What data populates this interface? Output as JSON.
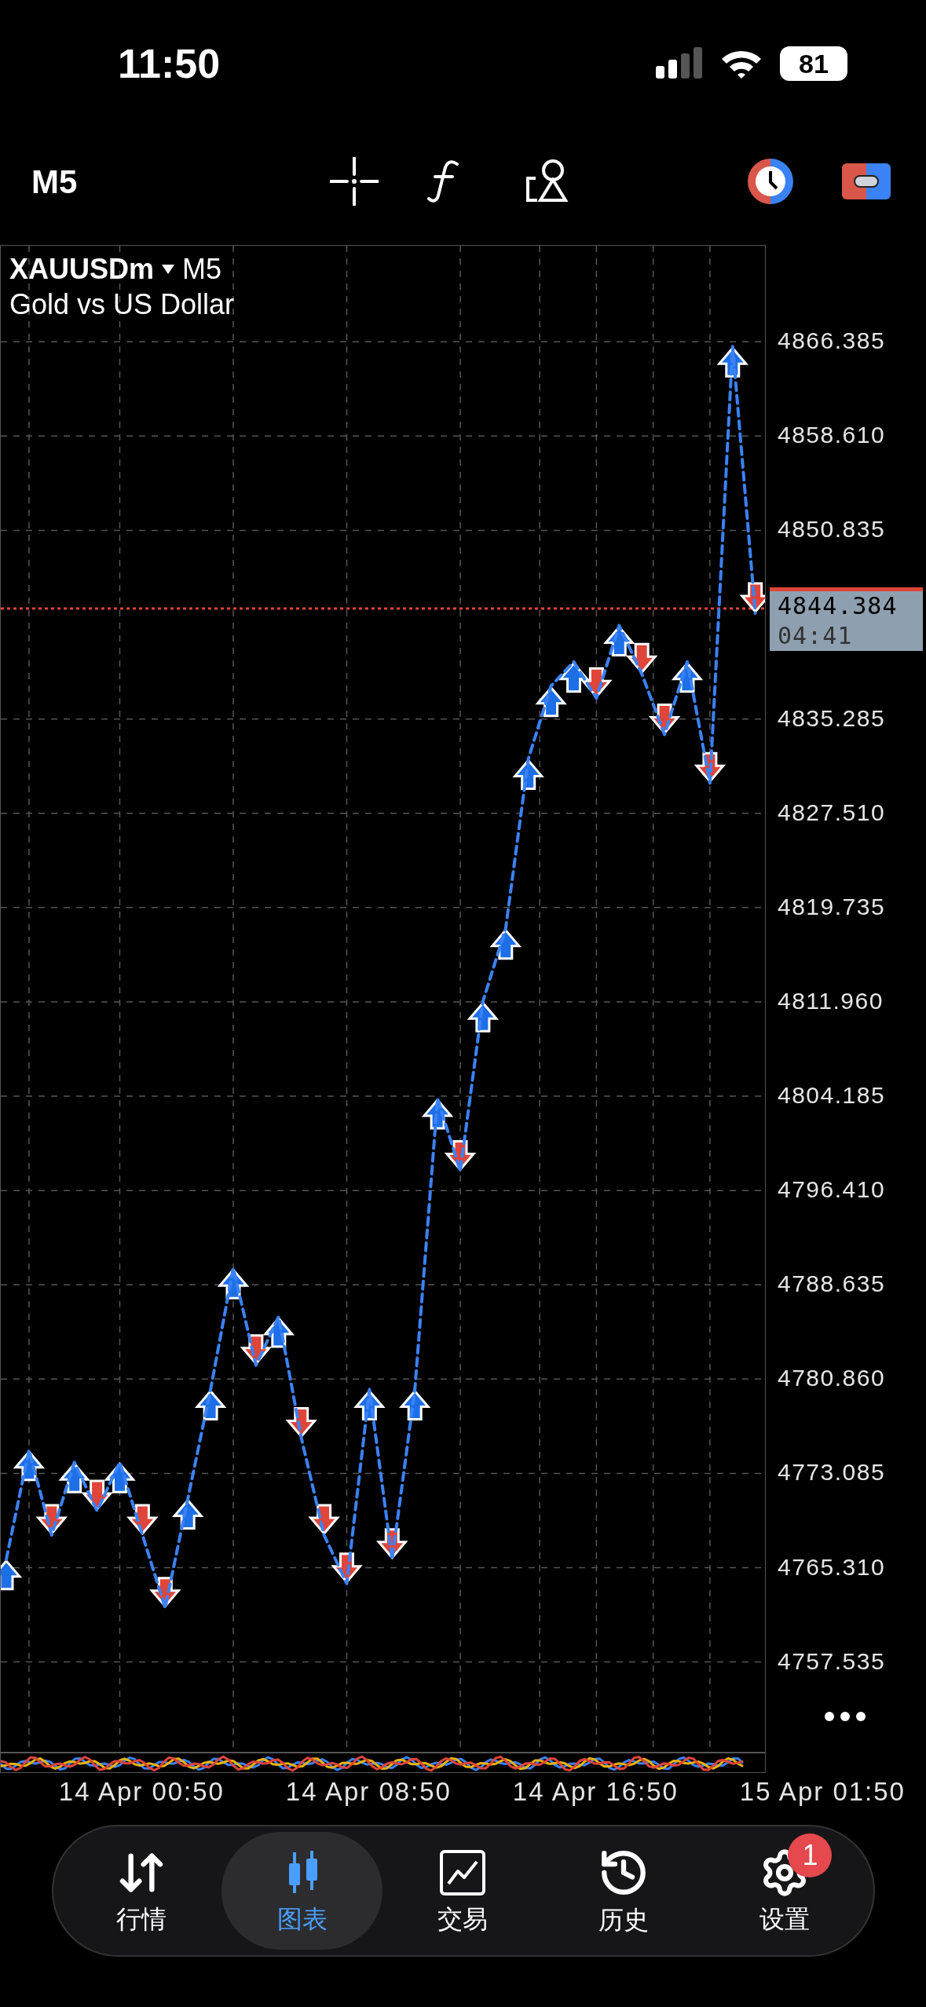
{
  "status_bar": {
    "time": "11:50",
    "battery": "81"
  },
  "toolbar": {
    "timeframe": "M5"
  },
  "chart": {
    "symbol": "XAUUSDm",
    "symbol_timeframe": "M5",
    "description": "Gold vs US Dollar",
    "current_price": "4844.384",
    "countdown": "04:41",
    "chart_data": {
      "type": "line",
      "categories": [
        null,
        null,
        null,
        null,
        null,
        null,
        "14 Apr 00:50",
        null,
        null,
        null,
        null,
        null,
        null,
        null,
        null,
        null,
        "14 Apr 08:50",
        null,
        null,
        null,
        null,
        null,
        null,
        null,
        null,
        null,
        "14 Apr 16:50",
        null,
        null,
        null,
        null,
        null,
        null,
        null,
        null,
        null,
        "15 Apr 01:50"
      ],
      "grid": true,
      "ref_lines": [
        {
          "axis": "y",
          "value": 4844.384,
          "color": "#e0453a"
        }
      ],
      "series": [
        {
          "color": "#3b82f6",
          "line_style": "dashed",
          "values": [
            4766,
            4775,
            4768,
            4774,
            4770,
            4774,
            4768,
            4762,
            4771,
            4780,
            4790,
            4782,
            4786,
            4776,
            4768,
            4764,
            4780,
            4766,
            4780,
            4804,
            4798,
            4812,
            4818,
            4832,
            4838,
            4840,
            4837,
            4843,
            4839,
            4834,
            4840,
            4830,
            4866,
            4844,
            null,
            null,
            null
          ]
        }
      ],
      "ylim": [
        4750,
        4874.3
      ],
      "yticks": [
        {
          "value": 4866.385,
          "label": "4866.385"
        },
        {
          "value": 4858.61,
          "label": "4858.610"
        },
        {
          "value": 4850.835,
          "label": "4850.835"
        },
        {
          "value": 4835.285,
          "label": "4835.285"
        },
        {
          "value": 4827.51,
          "label": "4827.510"
        },
        {
          "value": 4819.735,
          "label": "4819.735"
        },
        {
          "value": 4811.96,
          "label": "4811.960"
        },
        {
          "value": 4804.185,
          "label": "4804.185"
        },
        {
          "value": 4796.41,
          "label": "4796.410"
        },
        {
          "value": 4788.635,
          "label": "4788.635"
        },
        {
          "value": 4780.86,
          "label": "4780.860"
        },
        {
          "value": 4773.085,
          "label": "4773.085"
        },
        {
          "value": 4765.31,
          "label": "4765.310"
        },
        {
          "value": 4757.535,
          "label": "4757.535"
        }
      ]
    }
  },
  "tab_bar": [
    {
      "label": "行情",
      "selected": false
    },
    {
      "label": "图表",
      "selected": true
    },
    {
      "label": "交易",
      "selected": false
    },
    {
      "label": "历史",
      "selected": false
    },
    {
      "label": "设置",
      "selected": false,
      "badge": "1"
    }
  ]
}
